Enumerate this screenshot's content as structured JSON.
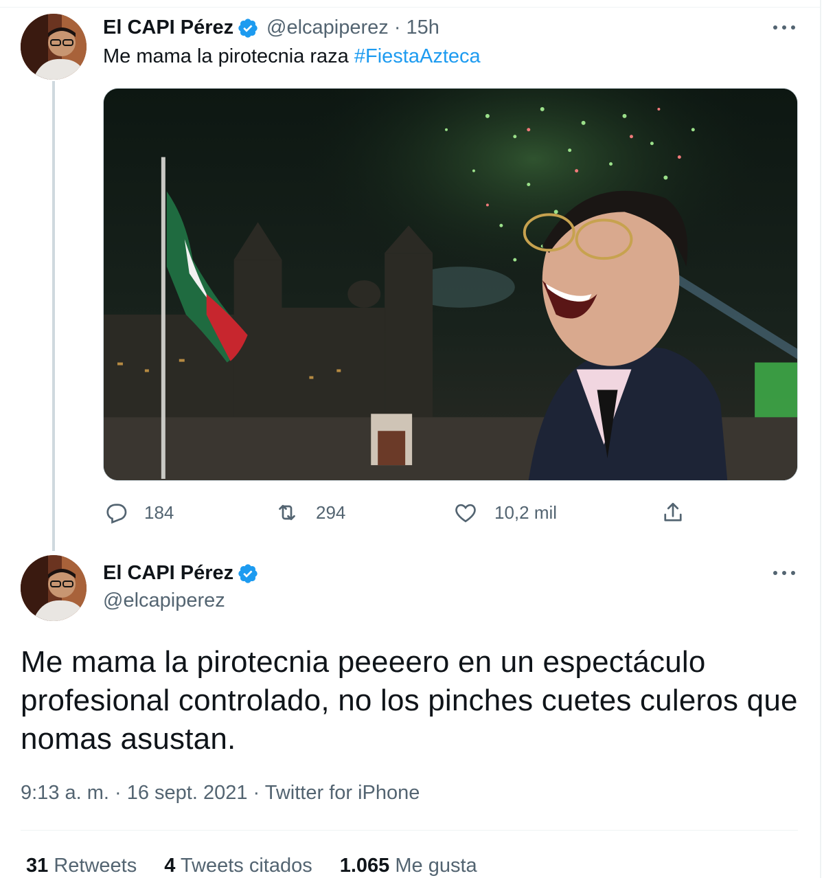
{
  "tweet1": {
    "name": "El CAPI Pérez",
    "handle": "@elcapiperez",
    "time_sep": " · ",
    "time": "15h",
    "text": "Me mama la pirotecnia raza ",
    "hashtag": "#FiestaAzteca",
    "actions": {
      "replies": "184",
      "retweets": "294",
      "likes": "10,2 mil"
    }
  },
  "tweet2": {
    "name": "El CAPI Pérez",
    "handle": "@elcapiperez",
    "text": "Me mama la pirotecnia peeeero en un espectáculo profesional controlado, no los pinches cuetes culeros que nomas asustan.",
    "meta": "9:13 a. m. · 16 sept. 2021 · Twitter for iPhone",
    "stats": {
      "retweets_count": "31",
      "retweets_label": "Retweets",
      "quotes_count": "4",
      "quotes_label": "Tweets citados",
      "likes_count": "1.065",
      "likes_label": "Me gusta"
    }
  },
  "colors": {
    "link": "#1d9bf0",
    "secondary_text": "#536471",
    "primary_text": "#0f1419",
    "verified": "#1d9bf0"
  },
  "icons": [
    "verified-badge-icon",
    "more-options-icon",
    "reply-icon",
    "retweet-icon",
    "like-icon",
    "share-icon"
  ]
}
